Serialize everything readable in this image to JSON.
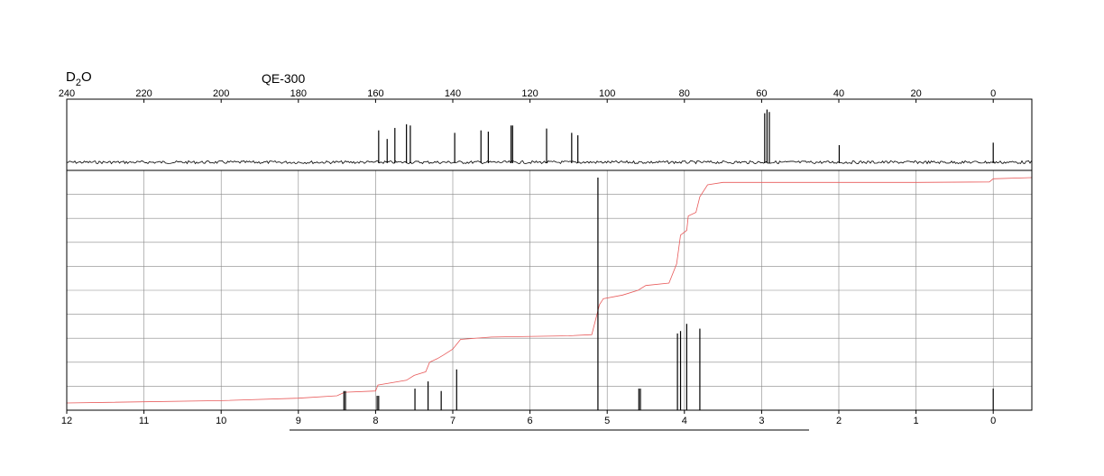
{
  "header": {
    "solvent": "D",
    "solvent_sub": "2",
    "solvent_tail": "O",
    "instrument": "QE-300"
  },
  "colors": {
    "trace": "#000000",
    "integral": "#e85a5a",
    "grid": "#888888",
    "frame": "#000000"
  },
  "chart_data": [
    {
      "type": "line",
      "title": "",
      "xlabel": "",
      "ylabel": "",
      "x_axis_position": "top",
      "xlim": [
        240,
        -10
      ],
      "ticks": [
        240,
        220,
        200,
        180,
        160,
        140,
        120,
        100,
        80,
        60,
        40,
        20,
        0
      ],
      "tick_labels": [
        "240",
        "220",
        "200",
        "180",
        "160",
        "140",
        "120",
        "100",
        "80",
        "60",
        "40",
        "20",
        "0"
      ],
      "grid": false,
      "noise": true,
      "ylim": [
        0,
        100
      ],
      "peaks": [
        {
          "x": 159.2,
          "h": 52
        },
        {
          "x": 157.0,
          "h": 38
        },
        {
          "x": 155.0,
          "h": 56
        },
        {
          "x": 152.0,
          "h": 62
        },
        {
          "x": 151.0,
          "h": 60
        },
        {
          "x": 139.5,
          "h": 48
        },
        {
          "x": 132.7,
          "h": 52
        },
        {
          "x": 130.8,
          "h": 50
        },
        {
          "x": 124.9,
          "h": 60
        },
        {
          "x": 124.5,
          "h": 60
        },
        {
          "x": 115.7,
          "h": 55
        },
        {
          "x": 109.2,
          "h": 48
        },
        {
          "x": 107.6,
          "h": 44
        },
        {
          "x": 59.2,
          "h": 80
        },
        {
          "x": 58.6,
          "h": 86
        },
        {
          "x": 58.0,
          "h": 82
        },
        {
          "x": 39.9,
          "h": 28
        },
        {
          "x": 0.0,
          "h": 32
        }
      ]
    },
    {
      "type": "line",
      "title": "",
      "xlabel": "",
      "ylabel": "",
      "x_axis_position": "bottom",
      "xlim": [
        12,
        -0.5
      ],
      "ticks": [
        12,
        11,
        10,
        9,
        8,
        7,
        6,
        5,
        4,
        3,
        2,
        1,
        0
      ],
      "tick_labels": [
        "12",
        "11",
        "10",
        "9",
        "8",
        "7",
        "6",
        "5",
        "4",
        "3",
        "2",
        "1",
        "0"
      ],
      "grid": true,
      "grid_rows": 10,
      "ylim": [
        0,
        100
      ],
      "peaks": [
        {
          "x": 8.41,
          "h": 8
        },
        {
          "x": 8.39,
          "h": 8
        },
        {
          "x": 7.98,
          "h": 6
        },
        {
          "x": 7.96,
          "h": 6
        },
        {
          "x": 7.49,
          "h": 9
        },
        {
          "x": 7.32,
          "h": 12
        },
        {
          "x": 7.15,
          "h": 8
        },
        {
          "x": 6.95,
          "h": 17
        },
        {
          "x": 5.12,
          "h": 97
        },
        {
          "x": 4.59,
          "h": 9
        },
        {
          "x": 4.57,
          "h": 9
        },
        {
          "x": 4.09,
          "h": 32
        },
        {
          "x": 4.05,
          "h": 33
        },
        {
          "x": 3.97,
          "h": 36
        },
        {
          "x": 3.8,
          "h": 34
        },
        {
          "x": 0.0,
          "h": 9
        }
      ],
      "integral": [
        [
          12.0,
          3
        ],
        [
          10.0,
          4
        ],
        [
          9.0,
          5
        ],
        [
          8.5,
          6
        ],
        [
          8.4,
          7.5
        ],
        [
          8.0,
          8
        ],
        [
          7.97,
          10.5
        ],
        [
          7.6,
          12.5
        ],
        [
          7.5,
          14.5
        ],
        [
          7.35,
          16
        ],
        [
          7.3,
          20
        ],
        [
          7.2,
          21.5
        ],
        [
          7.12,
          23
        ],
        [
          7.0,
          25.5
        ],
        [
          6.9,
          29.5
        ],
        [
          6.5,
          30.5
        ],
        [
          5.5,
          31
        ],
        [
          5.2,
          31.5
        ],
        [
          5.1,
          44
        ],
        [
          5.05,
          46.5
        ],
        [
          4.8,
          48
        ],
        [
          4.6,
          50
        ],
        [
          4.5,
          52
        ],
        [
          4.2,
          53
        ],
        [
          4.1,
          61
        ],
        [
          4.05,
          73
        ],
        [
          3.97,
          75
        ],
        [
          3.95,
          81
        ],
        [
          3.85,
          82.5
        ],
        [
          3.8,
          89
        ],
        [
          3.7,
          94
        ],
        [
          3.5,
          95
        ],
        [
          1.0,
          95
        ],
        [
          0.05,
          95.2
        ],
        [
          0.0,
          96.5
        ],
        [
          -0.5,
          97
        ]
      ]
    }
  ]
}
